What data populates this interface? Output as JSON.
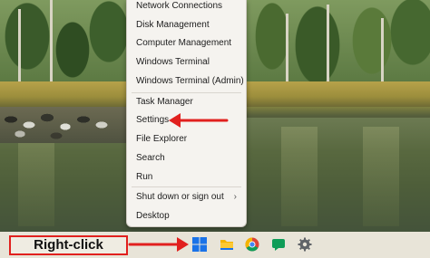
{
  "context_menu": {
    "items": [
      {
        "label": "Network Connections"
      },
      {
        "label": "Disk Management"
      },
      {
        "label": "Computer Management"
      },
      {
        "label": "Windows Terminal"
      },
      {
        "label": "Windows Terminal (Admin)"
      },
      {
        "label": "Task Manager"
      },
      {
        "label": "Settings"
      },
      {
        "label": "File Explorer"
      },
      {
        "label": "Search"
      },
      {
        "label": "Run"
      },
      {
        "label": "Shut down or sign out",
        "has_submenu": true,
        "submenu_glyph": "›"
      },
      {
        "label": "Desktop"
      }
    ]
  },
  "annotation": {
    "label": "Right-click",
    "color": "#e1201e",
    "highlighted_item": "Settings"
  },
  "taskbar": {
    "icons": [
      {
        "name": "windows-start-icon",
        "color": "#1a73e8"
      },
      {
        "name": "file-explorer-icon",
        "color": "#f4b400"
      },
      {
        "name": "chrome-icon",
        "color": "#db4437"
      },
      {
        "name": "chat-icon",
        "color": "#0f9d58"
      },
      {
        "name": "settings-gear-icon",
        "color": "#5f6368"
      }
    ]
  }
}
